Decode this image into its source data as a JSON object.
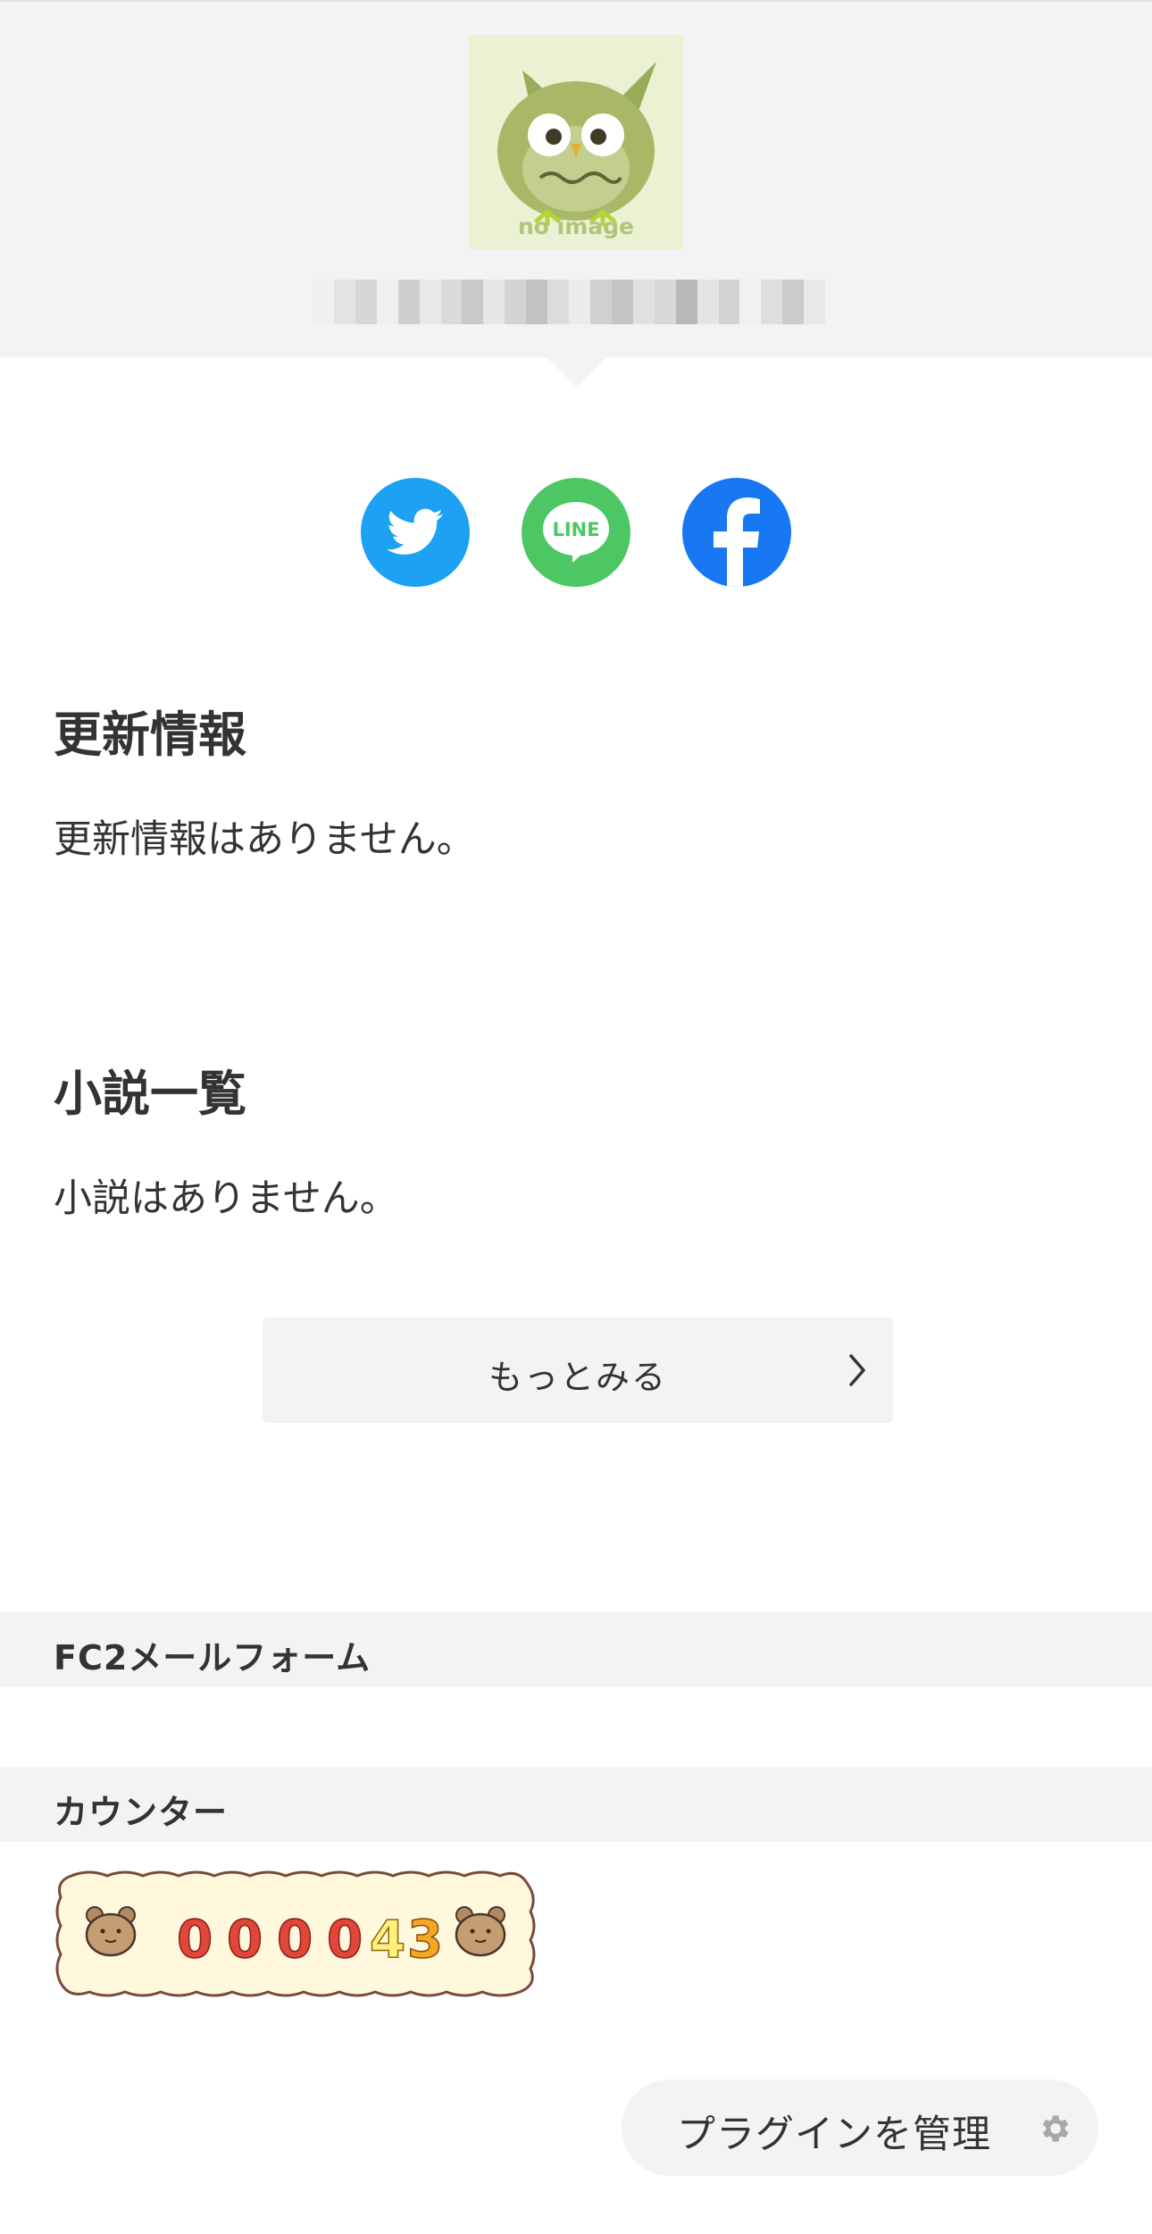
{
  "profile": {
    "avatar_caption": "no image",
    "blur_tones": [
      "#f0f0f0",
      "#e3e3e3",
      "#d6d6d6",
      "#efefef",
      "#cfcfcf",
      "#e8e8e8",
      "#dadada",
      "#c9c9c9",
      "#e6e6e6",
      "#d3d3d3",
      "#c2c2c2",
      "#dcdcdc",
      "#ebebeb",
      "#d0d0d0",
      "#c5c5c5",
      "#e1e1e1",
      "#d8d8d8",
      "#b9b9b9",
      "#e4e4e4",
      "#d2d2d2",
      "#f1f1f1",
      "#dedede",
      "#cbcbcb",
      "#e9e9e9"
    ]
  },
  "share": {
    "twitter_icon": "twitter-bird-icon",
    "line_icon": "line-icon",
    "line_text": "LINE",
    "facebook_icon": "facebook-f-icon",
    "colors": {
      "twitter": "#1da1f2",
      "line": "#4cc764",
      "facebook": "#1877f2"
    }
  },
  "updates": {
    "title": "更新情報",
    "empty_text": "更新情報はありません。"
  },
  "novels": {
    "title": "小説一覧",
    "empty_text": "小説はありません。",
    "more_label": "もっとみる"
  },
  "plugins": {
    "mailform_title": "FC2メールフォーム",
    "counter_title": "カウンター",
    "counter_digits": [
      "0",
      "0",
      "0",
      "0",
      "4",
      "3"
    ]
  },
  "footer": {
    "manage_label": "プラグインを管理",
    "manage_icon": "gear-icon"
  }
}
